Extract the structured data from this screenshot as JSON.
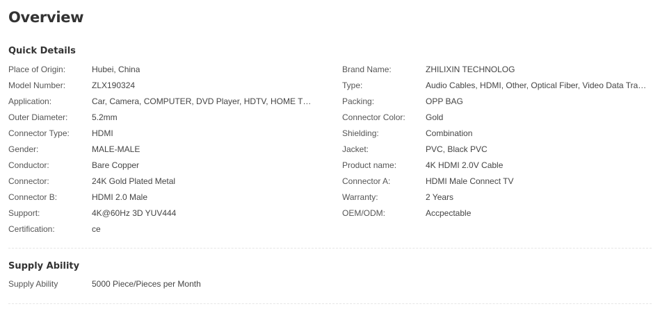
{
  "overview": {
    "title": "Overview"
  },
  "quick_details": {
    "title": "Quick Details",
    "left": [
      {
        "key": "Place of Origin:",
        "value": "Hubei, China"
      },
      {
        "key": "Model Number:",
        "value": "ZLX190324"
      },
      {
        "key": "Application:",
        "value": "Car, Camera, COMPUTER, DVD Player, HDTV, HOME THEATE..."
      },
      {
        "key": "Outer Diameter:",
        "value": "5.2mm"
      },
      {
        "key": "Connector Type:",
        "value": "HDMI"
      },
      {
        "key": "Gender:",
        "value": "MALE-MALE"
      },
      {
        "key": "Conductor:",
        "value": "Bare Copper"
      },
      {
        "key": "Connector:",
        "value": "24K Gold Plated Metal"
      },
      {
        "key": "Connector B:",
        "value": "HDMI 2.0 Male"
      },
      {
        "key": "Support:",
        "value": "4K@60Hz 3D YUV444"
      },
      {
        "key": "Certification:",
        "value": "ce"
      }
    ],
    "right": [
      {
        "key": "Brand Name:",
        "value": "ZHILIXIN TECHNOLOG"
      },
      {
        "key": "Type:",
        "value": "Audio Cables, HDMI, Other, Optical Fiber, Video Data Transm..."
      },
      {
        "key": "Packing:",
        "value": "OPP BAG"
      },
      {
        "key": "Connector Color:",
        "value": "Gold"
      },
      {
        "key": "Shielding:",
        "value": "Combination"
      },
      {
        "key": "Jacket:",
        "value": "PVC, Black PVC"
      },
      {
        "key": "Product name:",
        "value": "4K HDMI 2.0V Cable"
      },
      {
        "key": "Connector A:",
        "value": "HDMI Male Connect TV"
      },
      {
        "key": "Warranty:",
        "value": "2 Years"
      },
      {
        "key": "OEM/ODM:",
        "value": "Accpectable"
      }
    ]
  },
  "supply_ability": {
    "title": "Supply Ability",
    "key": "Supply Ability",
    "value": "5000 Piece/Pieces per Month"
  }
}
